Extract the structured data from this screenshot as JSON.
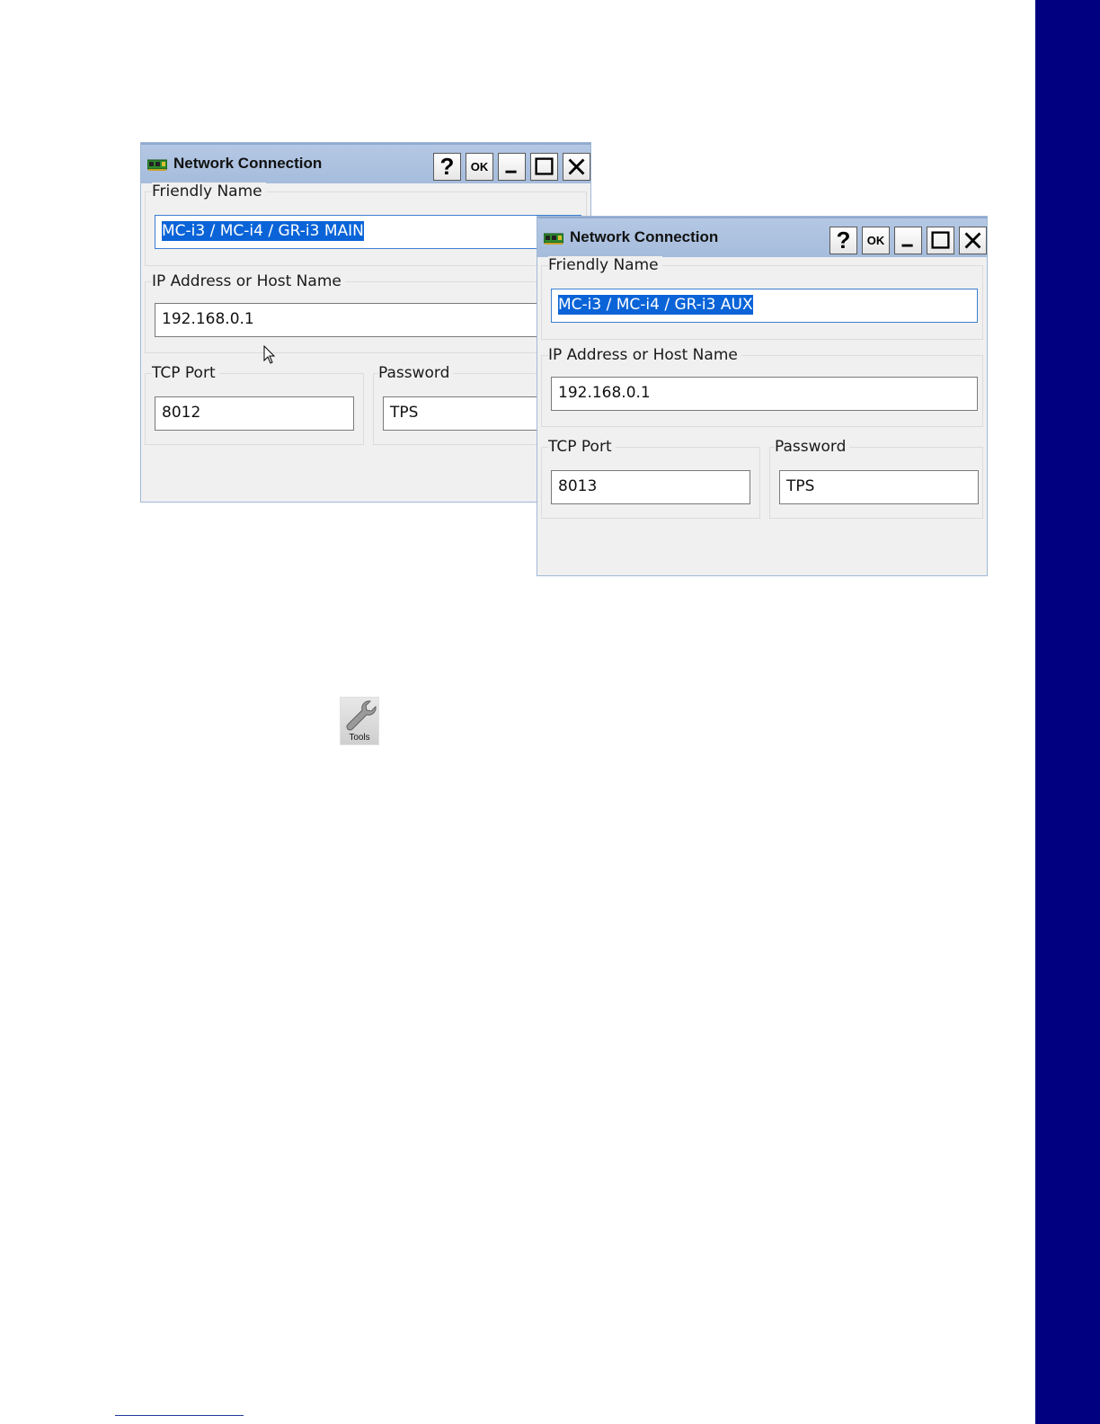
{
  "windows": [
    {
      "title": "Network Connection",
      "buttons": {
        "help": "?",
        "ok": "OK"
      },
      "friendly_name": {
        "label": "Friendly Name",
        "value": "MC-i3 / MC-i4 / GR-i3 MAIN"
      },
      "ip_address": {
        "label": "IP Address or Host Name",
        "value": "192.168.0.1"
      },
      "tcp_port": {
        "label": "TCP Port",
        "value": "8012"
      },
      "password": {
        "label": "Password",
        "value": "TPS"
      }
    },
    {
      "title": "Network Connection",
      "buttons": {
        "help": "?",
        "ok": "OK"
      },
      "friendly_name": {
        "label": "Friendly Name",
        "value": "MC-i3 / MC-i4 / GR-i3 AUX"
      },
      "ip_address": {
        "label": "IP Address or Host Name",
        "value": "192.168.0.1"
      },
      "tcp_port": {
        "label": "TCP Port",
        "value": "8013"
      },
      "password": {
        "label": "Password",
        "value": "TPS"
      }
    }
  ],
  "tools_button": {
    "label": "Tools",
    "icon": "wrench-icon"
  },
  "colors": {
    "side_band": "#000080",
    "titlebar": "#a6bcdc",
    "selection": "#0a64d8",
    "dialog_bg": "#f0f0f0"
  }
}
